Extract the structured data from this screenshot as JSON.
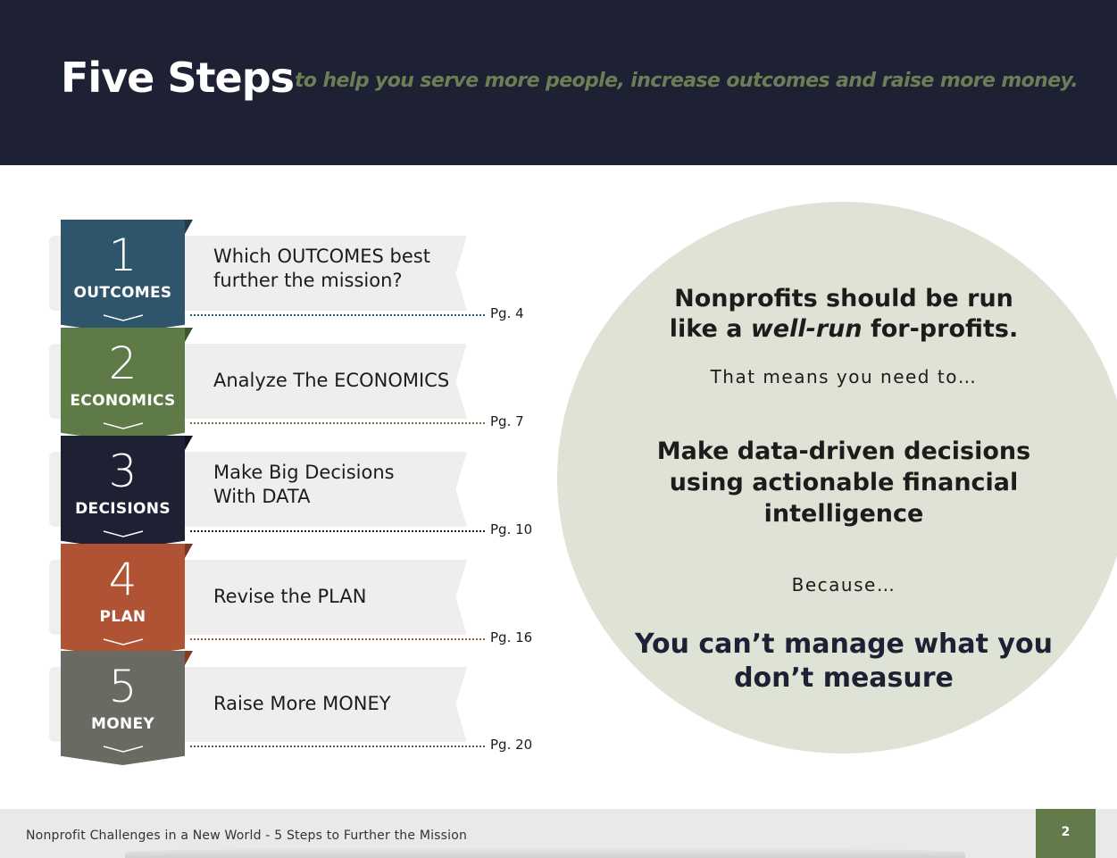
{
  "header": {
    "title": "Five Steps",
    "subtitle": "to help you serve more people, increase outcomes and raise more money."
  },
  "steps": [
    {
      "number": "1",
      "label": "OUTCOMES",
      "text": "Which OUTCOMES best further the mission?",
      "page": "Pg. 4",
      "color": "#2e556b",
      "fold": "#223c4c",
      "dots": "#2e5a7a"
    },
    {
      "number": "2",
      "label": "ECONOMICS",
      "text": "Analyze The ECONOMICS",
      "page": "Pg. 7",
      "color": "#5e7a46",
      "fold": "#3f5530",
      "dots": "#5e7a46"
    },
    {
      "number": "3",
      "label": "DECISIONS",
      "text": "Make Big Decisions With DATA",
      "page": "Pg. 10",
      "color": "#1e2133",
      "fold": "#111320",
      "dots": "#1e2133"
    },
    {
      "number": "4",
      "label": "PLAN",
      "text": "Revise the PLAN",
      "page": "Pg. 16",
      "color": "#b05234",
      "fold": "#7a3622",
      "dots": "#b05234"
    },
    {
      "number": "5",
      "label": "MONEY",
      "text": "Raise More MONEY",
      "page": "Pg. 20",
      "color": "#6a6a62",
      "fold": "#8a3a22",
      "dots": "#555555"
    }
  ],
  "callout": {
    "line1_a": "Nonprofits should be run",
    "line1_b": "like a ",
    "line1_em": "well-run",
    "line1_c": " for-profits.",
    "line2": "That means you need to…",
    "line3": "Make data-driven decisions using actionable financial intelligence",
    "line4": "Because…",
    "line5": "You can’t manage what you don’t measure",
    "bg_color": "#dee3d6"
  },
  "footer": {
    "text": "Nonprofit Challenges in a New World - 5 Steps to Further the Mission",
    "page_number": "2",
    "accent": "#637a4b"
  }
}
